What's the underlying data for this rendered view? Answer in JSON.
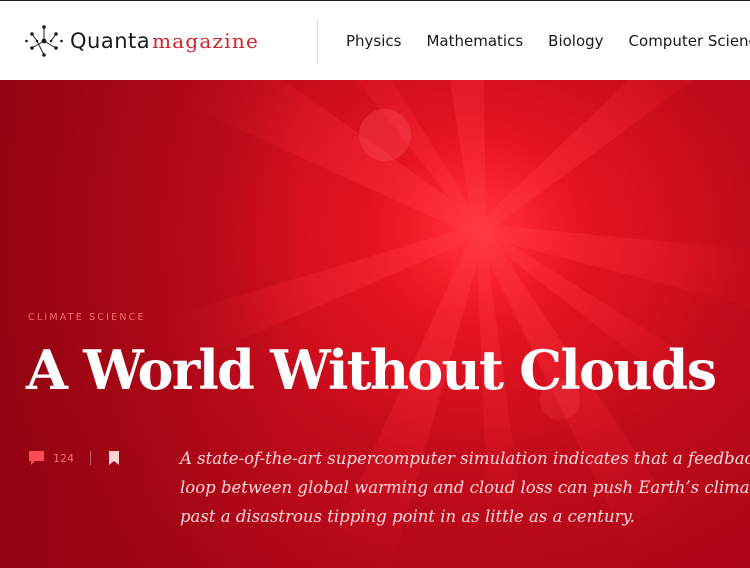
{
  "header": {
    "logo": {
      "word1": "Quanta",
      "word2": "magazine",
      "brand_color": "#d1232a"
    },
    "nav": [
      {
        "label": "Physics"
      },
      {
        "label": "Mathematics"
      },
      {
        "label": "Biology"
      },
      {
        "label": "Computer Science"
      }
    ]
  },
  "hero": {
    "background_color": "#c50c1c",
    "kicker": "CLIMATE SCIENCE",
    "title": "A World Without Clouds",
    "comments": {
      "icon": "comment-icon",
      "count": "124"
    },
    "bookmark": {
      "icon": "bookmark-icon"
    },
    "dek_lines": [
      "A state-of-the-art supercomputer simulation indicates that a feedback",
      "loop between global warming and cloud loss can push Earth’s climate",
      "past a disastrous tipping point in as little as a century."
    ]
  }
}
